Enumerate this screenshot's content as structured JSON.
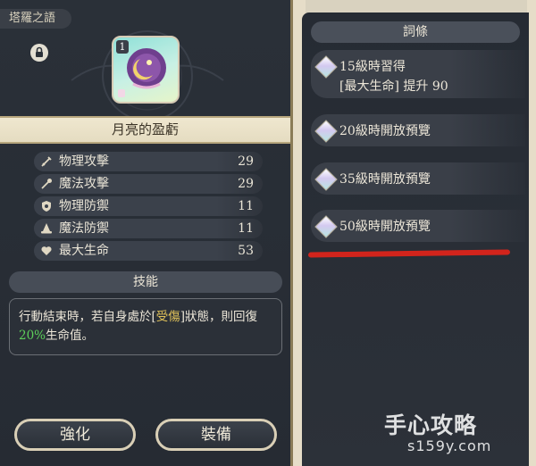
{
  "left": {
    "tab_label": "塔羅之語",
    "card_level": "1",
    "item_name": "月亮的盈虧",
    "stats": [
      {
        "icon": "sword-icon",
        "label": "物理攻擊",
        "value": "29"
      },
      {
        "icon": "wand-icon",
        "label": "魔法攻擊",
        "value": "29"
      },
      {
        "icon": "shield-icon",
        "label": "物理防禦",
        "value": "11"
      },
      {
        "icon": "hat-icon",
        "label": "魔法防禦",
        "value": "11"
      },
      {
        "icon": "heart-icon",
        "label": "最大生命",
        "value": "53"
      }
    ],
    "skill_header": "技能",
    "skill_text": {
      "part1": "行動結束時，若自身處於[",
      "keyword": "受傷",
      "part2": "]狀態，則回復",
      "percent": "20%",
      "part3": "生命值。"
    },
    "buttons": {
      "enhance": "強化",
      "equip": "裝備"
    }
  },
  "right": {
    "header": "詞條",
    "entries": [
      {
        "title": "15級時習得",
        "detail": "[最大生命] 提升 90"
      },
      {
        "title": "20級時開放預覽"
      },
      {
        "title": "35級時開放預覽"
      },
      {
        "title": "50級時開放預覽"
      }
    ]
  },
  "watermark": {
    "main": "手心攻略",
    "sub": "s159y.com"
  },
  "colors": {
    "highlight_yellow": "#e2c35a",
    "highlight_green": "#5dd05a",
    "annotation_red": "#d2241c"
  }
}
